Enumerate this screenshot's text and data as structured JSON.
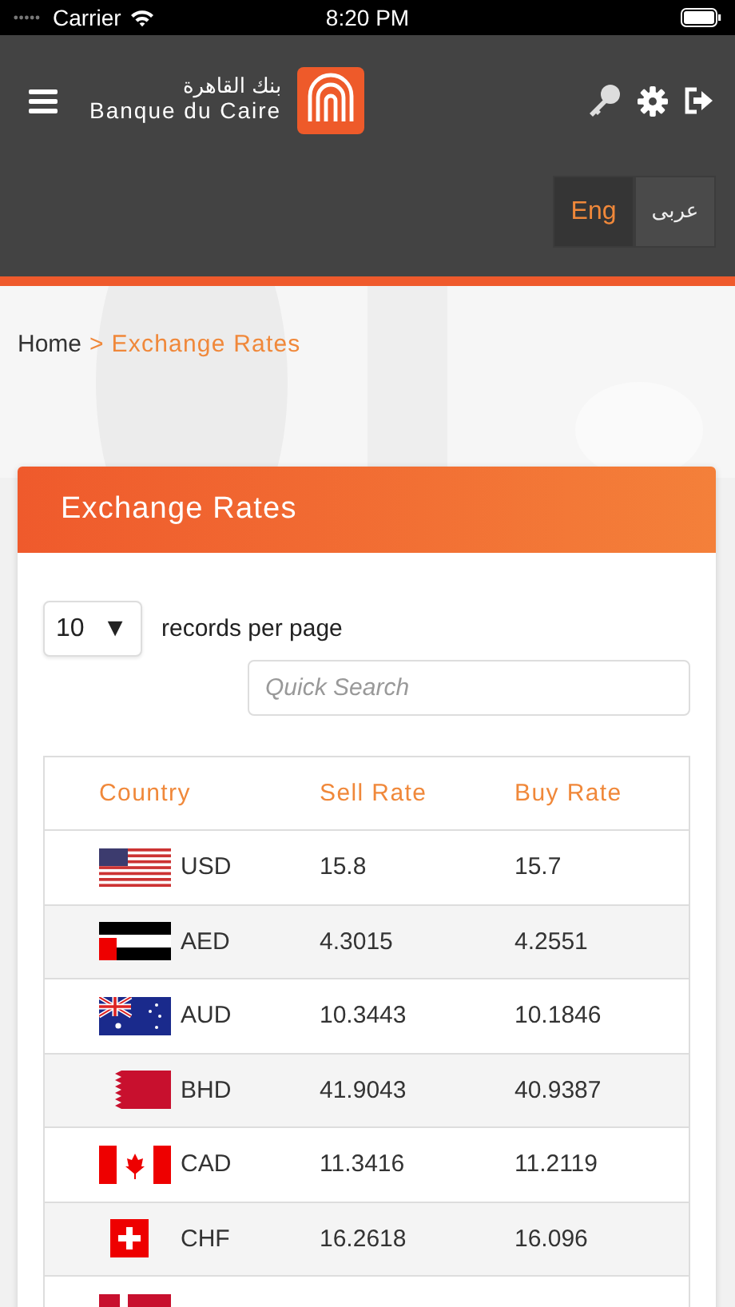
{
  "status_bar": {
    "carrier": "Carrier",
    "time": "8:20 PM"
  },
  "header": {
    "logo_arabic": "بنك القاهرة",
    "logo_latin": "Banque du Caire",
    "languages": [
      {
        "label": "Eng",
        "selected": true
      },
      {
        "label": "عربى",
        "selected": false
      }
    ]
  },
  "breadcrumb": {
    "home": "Home",
    "separator": ">",
    "current": "Exchange Rates"
  },
  "card": {
    "title": "Exchange Rates",
    "page_size": {
      "value": "10",
      "arrow": "▼",
      "label": "records per page"
    },
    "search": {
      "placeholder": "Quick Search"
    },
    "table": {
      "columns": [
        "Country",
        "Sell Rate",
        "Buy Rate"
      ],
      "rows": [
        {
          "kind": "us",
          "currency": "USD",
          "sell": "15.8",
          "buy": "15.7"
        },
        {
          "kind": "ae",
          "currency": "AED",
          "sell": "4.3015",
          "buy": "4.2551"
        },
        {
          "kind": "au",
          "currency": "AUD",
          "sell": "10.3443",
          "buy": "10.1846"
        },
        {
          "kind": "bh",
          "currency": "BHD",
          "sell": "41.9043",
          "buy": "40.9387"
        },
        {
          "kind": "ca",
          "currency": "CAD",
          "sell": "11.3416",
          "buy": "11.2119"
        },
        {
          "kind": "ch",
          "currency": "CHF",
          "sell": "16.2618",
          "buy": "16.096"
        },
        {
          "kind": "dk"
        }
      ]
    }
  }
}
